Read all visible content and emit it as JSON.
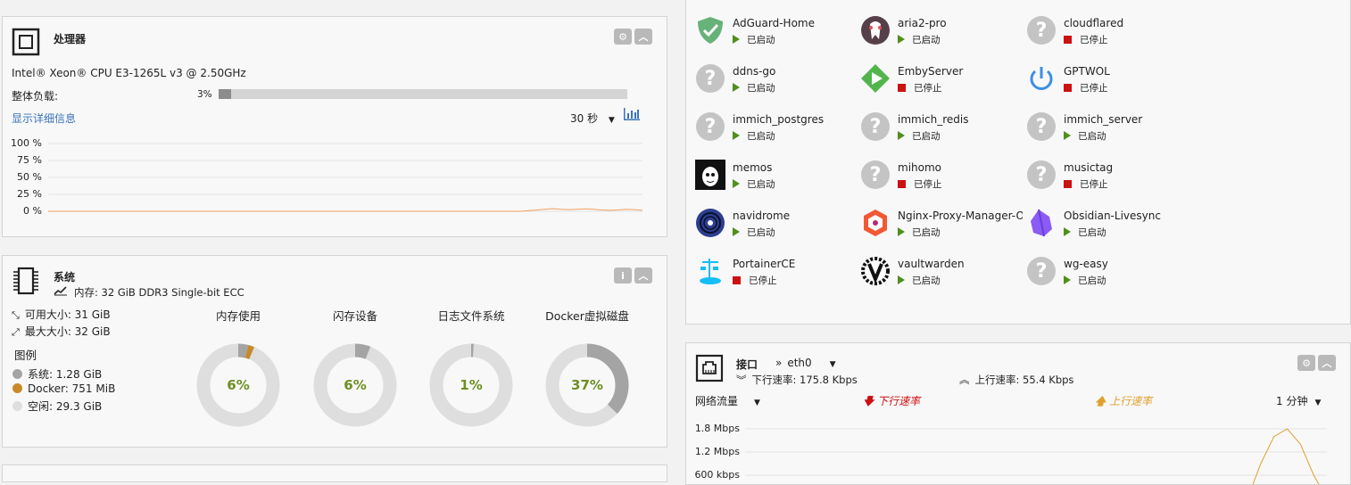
{
  "cpu": {
    "title": "处理器",
    "model": "Intel® Xeon® CPU E3-1265L v3 @ 2.50GHz",
    "load_label": "整体负载:",
    "load_value": "3%",
    "load_fraction": 0.03,
    "details_link": "显示详细信息",
    "interval": "30 秒",
    "chart_data": {
      "type": "line",
      "yticks": [
        "100 %",
        "75 %",
        "50 %",
        "25 %",
        "0 %"
      ],
      "ylim": [
        0,
        100
      ],
      "series": [
        {
          "values": [
            0,
            0,
            0,
            0,
            0,
            0,
            0,
            0,
            0,
            0,
            0,
            0,
            0,
            0,
            0,
            0,
            0,
            0,
            0,
            0,
            0,
            0,
            0,
            0,
            0,
            0,
            0,
            0,
            0,
            0,
            0,
            0,
            0,
            0,
            0,
            0,
            0,
            0,
            0,
            0,
            0,
            0,
            0,
            0,
            0,
            0,
            0,
            0,
            0,
            0,
            0,
            0,
            0,
            0,
            0,
            0,
            0,
            0,
            0,
            1,
            2,
            3,
            4,
            3,
            2.5,
            3,
            3.5,
            3,
            2,
            1.5,
            2,
            3,
            2.5,
            1.5
          ]
        }
      ]
    }
  },
  "system": {
    "title": "系统",
    "memory_line": "内存: 32 GiB DDR3 Single-bit ECC",
    "available": "可用大小: 31 GiB",
    "max": "最大大小: 32 GiB",
    "legend_title": "图例",
    "legend": [
      {
        "label": "系统: 1.28 GiB",
        "color": "#a4a4a4"
      },
      {
        "label": "Docker: 751 MiB",
        "color": "#c8892a"
      },
      {
        "label": "空闲: 29.3 GiB",
        "color": "#dedede"
      }
    ],
    "donuts": [
      {
        "title": "内存使用",
        "value": "6%",
        "segments": [
          {
            "fraction": 0.04,
            "color": "#a4a4a4"
          },
          {
            "fraction": 0.023,
            "color": "#c8892a"
          }
        ]
      },
      {
        "title": "闪存设备",
        "value": "6%",
        "segments": [
          {
            "fraction": 0.06,
            "color": "#a4a4a4"
          }
        ]
      },
      {
        "title": "日志文件系统",
        "value": "1%",
        "segments": [
          {
            "fraction": 0.01,
            "color": "#a4a4a4"
          }
        ]
      },
      {
        "title": "Docker虚拟磁盘",
        "value": "37%",
        "segments": [
          {
            "fraction": 0.37,
            "color": "#a4a4a4"
          }
        ]
      }
    ]
  },
  "apps": [
    {
      "name": "AdGuard-Home",
      "status": "已启动",
      "running": true,
      "icon": "adguard-icon"
    },
    {
      "name": "aria2-pro",
      "status": "已启动",
      "running": true,
      "icon": "aria2-icon"
    },
    {
      "name": "cloudflared",
      "status": "已停止",
      "running": false,
      "icon": "unknown-icon"
    },
    {
      "name": "ddns-go",
      "status": "已启动",
      "running": true,
      "icon": "unknown-icon"
    },
    {
      "name": "EmbyServer",
      "status": "已停止",
      "running": false,
      "icon": "emby-icon"
    },
    {
      "name": "GPTWOL",
      "status": "已停止",
      "running": false,
      "icon": "power-icon"
    },
    {
      "name": "immich_postgres",
      "status": "已启动",
      "running": true,
      "icon": "unknown-icon"
    },
    {
      "name": "immich_redis",
      "status": "已启动",
      "running": true,
      "icon": "unknown-icon"
    },
    {
      "name": "immich_server",
      "status": "已启动",
      "running": true,
      "icon": "unknown-icon"
    },
    {
      "name": "memos",
      "status": "已启动",
      "running": true,
      "icon": "memos-icon"
    },
    {
      "name": "mihomo",
      "status": "已停止",
      "running": false,
      "icon": "unknown-icon"
    },
    {
      "name": "musictag",
      "status": "已停止",
      "running": false,
      "icon": "unknown-icon"
    },
    {
      "name": "navidrome",
      "status": "已启动",
      "running": true,
      "icon": "navidrome-icon"
    },
    {
      "name": "Nginx-Proxy-Manager-Official",
      "status": "已启动",
      "running": true,
      "icon": "nginx-proxy-icon"
    },
    {
      "name": "Obsidian-Livesync",
      "status": "已启动",
      "running": true,
      "icon": "obsidian-icon"
    },
    {
      "name": "PortainerCE",
      "status": "已停止",
      "running": false,
      "icon": "portainer-icon"
    },
    {
      "name": "vaultwarden",
      "status": "已启动",
      "running": true,
      "icon": "vaultwarden-icon"
    },
    {
      "name": "wg-easy",
      "status": "已启动",
      "running": true,
      "icon": "unknown-icon"
    }
  ],
  "network": {
    "title": "接口",
    "interface": "eth0",
    "down_speed": "下行速率: 175.8 Kbps",
    "up_speed": "上行速率: 55.4 Kbps",
    "traffic_label": "网络流量",
    "legend_down": "下行速率",
    "legend_up": "上行速率",
    "interval": "1 分钟",
    "colors": {
      "down": "#cc1111",
      "up": "#e0a030"
    },
    "chart_data": {
      "type": "line",
      "yticks": [
        "1.8 Mbps",
        "1.2 Mbps",
        "600 kbps"
      ],
      "series": [
        {
          "name": "上行速率",
          "values": [
            0,
            0,
            0,
            0,
            0,
            0,
            0,
            0,
            0,
            0,
            0,
            0,
            0,
            0,
            0,
            0,
            0,
            0,
            0,
            0,
            0,
            0,
            0,
            0,
            0,
            0,
            0,
            0,
            0,
            0,
            0,
            0,
            0,
            0,
            0,
            0,
            0,
            0,
            0,
            0.9,
            1.6,
            1.8,
            1.4,
            0.6,
            0
          ]
        }
      ]
    }
  }
}
